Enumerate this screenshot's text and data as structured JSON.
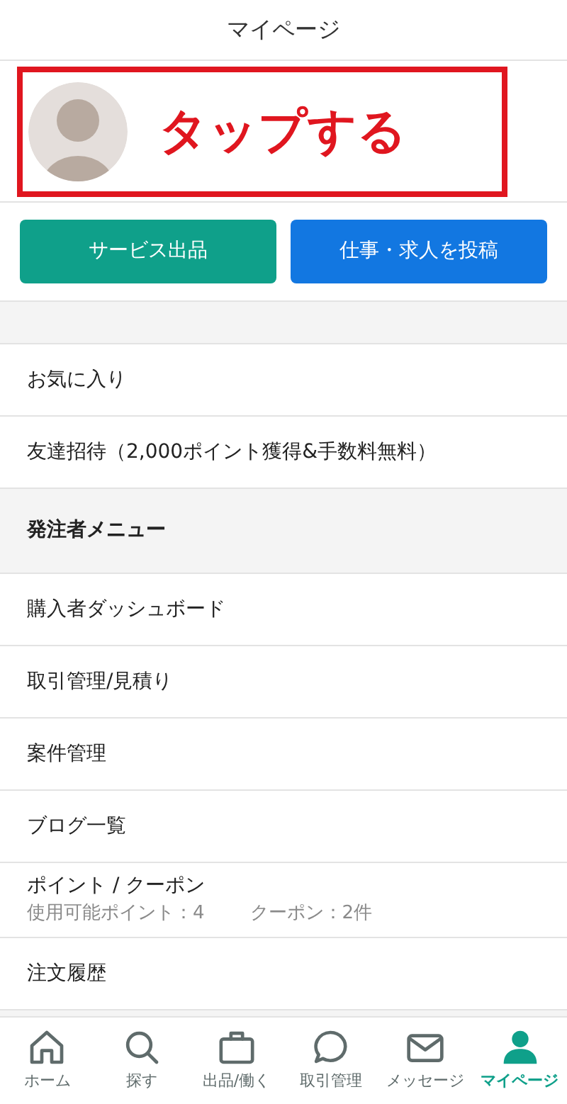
{
  "header": {
    "title": "マイページ"
  },
  "profile": {
    "annotation": "タップする"
  },
  "actions": [
    {
      "label": "サービス出品",
      "color": "#0fa08a"
    },
    {
      "label": "仕事・求人を投稿",
      "color": "#1277e1"
    }
  ],
  "menu": [
    {
      "kind": "item",
      "label": "お気に入り"
    },
    {
      "kind": "item",
      "label": "友達招待（2,000ポイント獲得&手数料無料）"
    },
    {
      "kind": "header",
      "label": "発注者メニュー"
    },
    {
      "kind": "item",
      "label": "購入者ダッシュボード"
    },
    {
      "kind": "item",
      "label": "取引管理/見積り"
    },
    {
      "kind": "item",
      "label": "案件管理"
    },
    {
      "kind": "item",
      "label": "ブログ一覧"
    },
    {
      "kind": "points",
      "label": "ポイント / クーポン",
      "points": "使用可能ポイント：4",
      "coupons": "クーポン：2件"
    },
    {
      "kind": "item",
      "label": "注文履歴"
    }
  ],
  "nav": [
    {
      "kind": "home",
      "label": "ホーム",
      "selected": false
    },
    {
      "kind": "search",
      "label": "探す",
      "selected": false
    },
    {
      "kind": "briefcase",
      "label": "出品/働く",
      "selected": false
    },
    {
      "kind": "chat",
      "label": "取引管理",
      "selected": false
    },
    {
      "kind": "mail",
      "label": "メッセージ",
      "selected": false
    },
    {
      "kind": "user",
      "label": "マイページ",
      "selected": true
    }
  ]
}
